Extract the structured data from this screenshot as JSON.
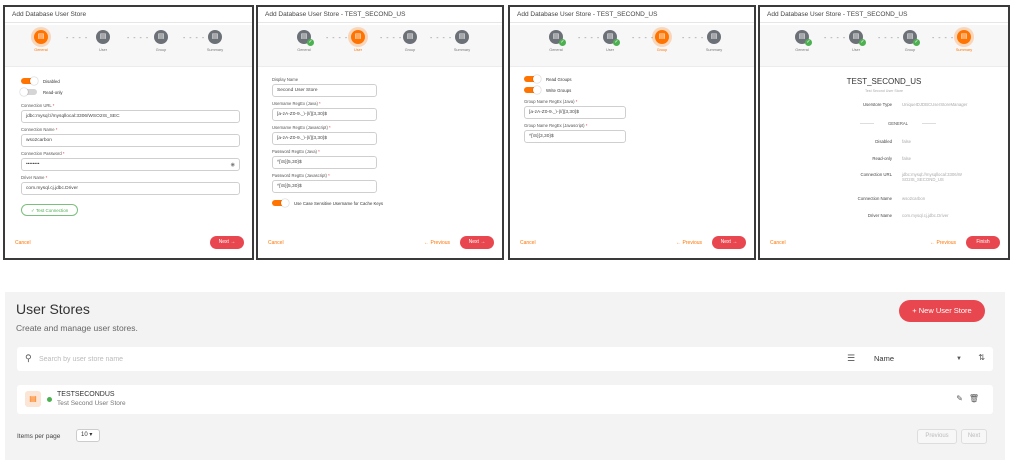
{
  "panel0": {
    "title": "Add Database User Store",
    "toggles": [
      {
        "label": "Disabled",
        "on": true
      },
      {
        "label": "Read-only",
        "on": false
      }
    ],
    "fields": [
      {
        "label": "Connection URL",
        "value": "jdbc:mysql://mysqllocal:3306/WSO2IS_SEC"
      },
      {
        "label": "Connection Name",
        "value": "wso2carbon"
      },
      {
        "label": "Connection Password",
        "value": "••••••••"
      },
      {
        "label": "Driver Name",
        "value": "com.mysql.cj.jdbc.Driver"
      }
    ],
    "test_connection": "Test Connection"
  },
  "panel1": {
    "title": "Add Database User Store - TEST_SECOND_US",
    "fields": [
      {
        "label": "Display Name",
        "value": "Second User Store",
        "req": false
      },
      {
        "label": "Username RegEx (Java)",
        "value": "[a-zA-Z0-9._\\-|//]{3,30}$",
        "req": true
      },
      {
        "label": "Username RegEx (Javascript)",
        "value": "[a-zA-Z0-9._\\-|//]{3,30}$",
        "req": true
      },
      {
        "label": "Password RegEx (Java)",
        "value": "^[\\S]{5,30}$",
        "req": true
      },
      {
        "label": "Password RegEx (Javascript)",
        "value": "^[\\S]{5,30}$",
        "req": true
      }
    ],
    "case_toggle": "Use Case Sensitive Username for Cache Keys"
  },
  "panel2": {
    "title": "Add Database User Store - TEST_SECOND_US",
    "toggles": [
      {
        "label": "Read Groups",
        "on": true
      },
      {
        "label": "Write Groups",
        "on": true
      }
    ],
    "fields": [
      {
        "label": "Group Name RegEx (Java)",
        "value": "[a-zA-Z0-9._\\-|//]{3,30}$"
      },
      {
        "label": "Group Name RegEx (Javascript)",
        "value": "^[\\S]{3,30}$"
      }
    ]
  },
  "panel3": {
    "title": "Add Database User Store - TEST_SECOND_US",
    "name": "TEST_SECOND_US",
    "desc": "Test Second User Store",
    "usertype": {
      "label": "Userstore Type",
      "value": "UniqueIDJDBCUserStoreManager"
    },
    "general": "GENERAL",
    "rows": [
      {
        "label": "Disabled",
        "value": "false"
      },
      {
        "label": "Read-only",
        "value": "false"
      },
      {
        "label": "Connection URL",
        "value": "jdbc:mysql://mysqllocal:3306/WSO2IS_SECOND_US"
      },
      {
        "label": "Connection Name",
        "value": "wso2carbon"
      },
      {
        "label": "Driver Name",
        "value": "com.mysql.cj.jdbc.Driver"
      }
    ]
  },
  "steps": [
    "General",
    "User",
    "Group",
    "Summary"
  ],
  "buttons": {
    "cancel": "Cancel",
    "previous": "Previous",
    "next": "Next",
    "finish": "Finish"
  },
  "userstores": {
    "title": "User Stores",
    "subtitle": "Create and manage user stores.",
    "new_button": "New User Store",
    "search_placeholder": "Search by user store name",
    "sort_label": "Name",
    "item": {
      "name": "TESTSECONDUS",
      "description": "Test Second User Store"
    },
    "items_per_page_label": "Items per page",
    "items_per_page": "10",
    "prev": "Previous",
    "next": "Next"
  },
  "colors": {
    "accent": "#ff7300",
    "primary_button": "#e9474f",
    "success": "#4caf50"
  },
  "icons": {
    "step": "database-icon",
    "complete": "check-icon",
    "search": "search-icon",
    "filter": "filter-icon",
    "sort": "sort-icon",
    "edit": "pencil-icon",
    "delete": "trash-icon",
    "userstore": "userstore-icon"
  }
}
